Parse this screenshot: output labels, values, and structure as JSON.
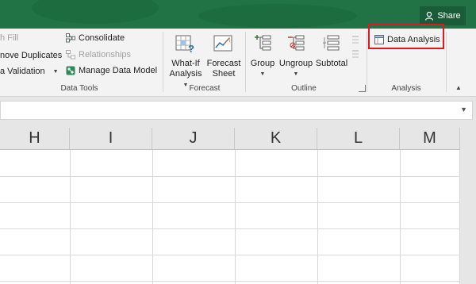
{
  "titlebar": {
    "share_label": "Share",
    "color": "#217346"
  },
  "data_tools": {
    "flash_fill": "h Fill",
    "remove_duplicates": "nove Duplicates",
    "data_validation": "a Validation",
    "consolidate": "Consolidate",
    "relationships": "Relationships",
    "manage_data_model": "Manage Data Model",
    "group_label": "Data Tools"
  },
  "forecast": {
    "whatif_line1": "What-If",
    "whatif_line2": "Analysis",
    "sheet_line1": "Forecast",
    "sheet_line2": "Sheet",
    "group_label": "Forecast"
  },
  "outline": {
    "group": "Group",
    "ungroup": "Ungroup",
    "subtotal": "Subtotal",
    "group_label": "Outline"
  },
  "analysis": {
    "data_analysis": "Data Analysis",
    "group_label": "Analysis",
    "highlight_color": "#e0191e"
  },
  "sheet": {
    "columns": [
      "H",
      "I",
      "J",
      "K",
      "L",
      "M"
    ]
  }
}
